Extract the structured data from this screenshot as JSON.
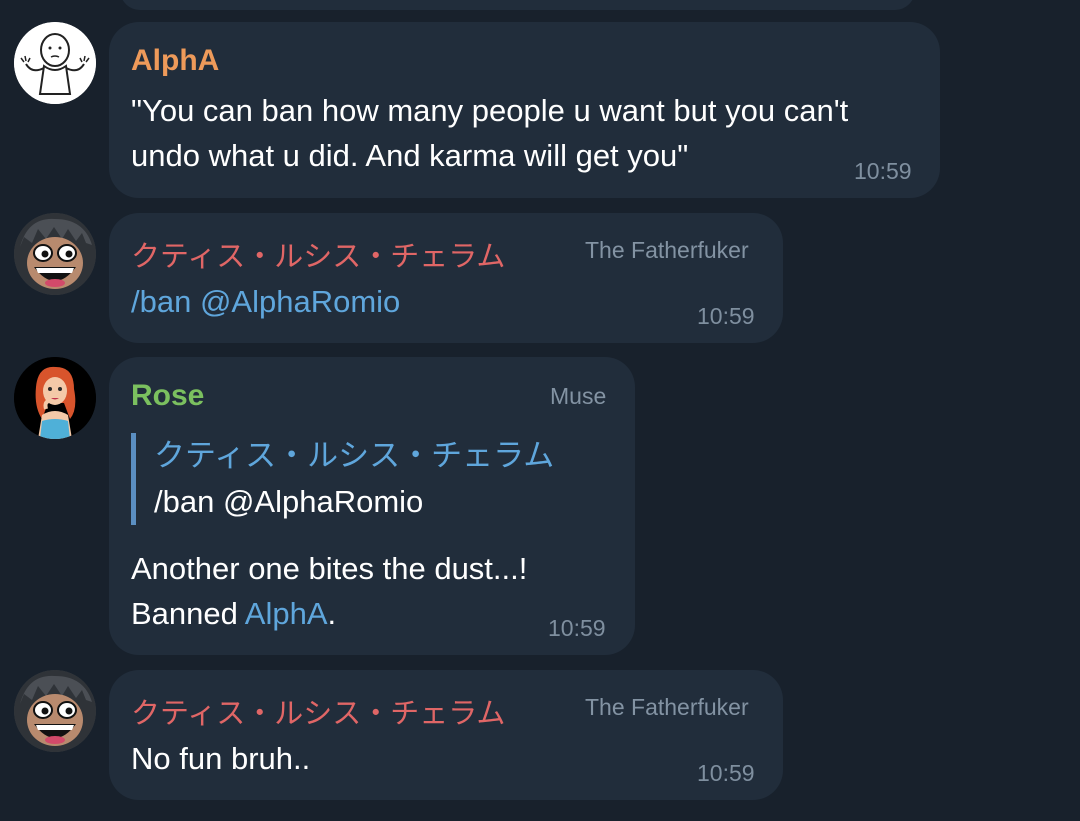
{
  "messages": [
    {
      "sender": "AlphA",
      "sender_color": "#ee9a5a",
      "text_lines": [
        "\"You can ban how many people u want but you can't",
        "undo what u did. And karma will get you\""
      ],
      "time": "10:59"
    },
    {
      "sender": "クティス・ルシス・チェラム",
      "sender_color": "#e06666",
      "role": "The Fatherfuker",
      "text": "/ban @AlphaRomio",
      "time": "10:59"
    },
    {
      "sender": "Rose",
      "sender_color": "#7bc05f",
      "role": "Muse",
      "reply": {
        "name": "クティス・ルシス・チェラム",
        "text": "/ban @AlphaRomio"
      },
      "text_line1": "Another one bites the dust...!",
      "text_line2_prefix": "Banned ",
      "text_line2_link": "AlphA",
      "text_line2_suffix": ".",
      "time": "10:59"
    },
    {
      "sender": "クティス・ルシス・チェラム",
      "sender_color": "#e06666",
      "role": "The Fatherfuker",
      "text": "No fun bruh..",
      "time": "10:59"
    }
  ],
  "colors": {
    "background": "#18212c",
    "bubble": "#212d3b",
    "link": "#5fa6dc",
    "muted": "#7f8f9f"
  },
  "icons": {
    "alpha_avatar": "shrug-meme-avatar-icon",
    "noctis_avatar": "grinning-face-avatar-icon",
    "rose_avatar": "redhead-girl-avatar-icon"
  }
}
